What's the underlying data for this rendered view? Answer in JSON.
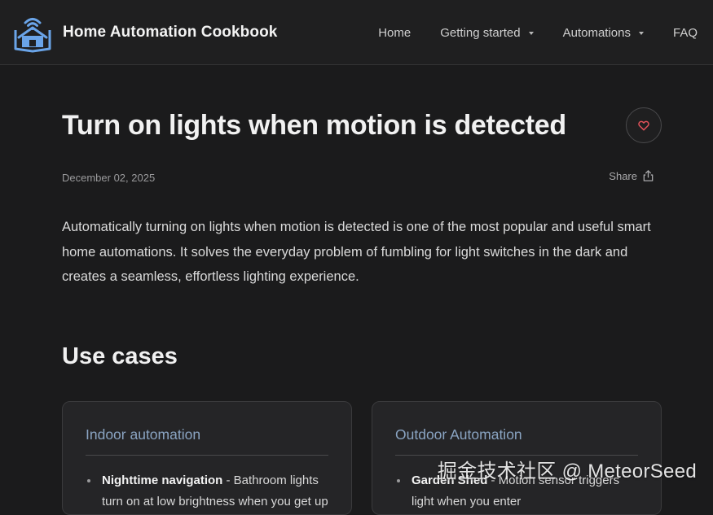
{
  "header": {
    "site_title": "Home Automation Cookbook",
    "logo_icon": "smart-home-wifi-icon",
    "nav": [
      {
        "label": "Home",
        "has_dropdown": false
      },
      {
        "label": "Getting started",
        "has_dropdown": true
      },
      {
        "label": "Automations",
        "has_dropdown": true
      },
      {
        "label": "FAQ",
        "has_dropdown": false
      }
    ]
  },
  "article": {
    "title": "Turn on lights when motion is detected",
    "favorite_icon": "heart-icon",
    "date": "December 02, 2025",
    "share_label": "Share",
    "share_icon": "share-icon",
    "intro": "Automatically turning on lights when motion is detected is one of the most popular and useful smart home automations. It solves the everyday problem of fumbling for light switches in the dark and creates a seamless, effortless lighting experience."
  },
  "use_cases": {
    "heading": "Use cases",
    "cards": [
      {
        "title": "Indoor automation",
        "items": [
          {
            "bold": "Nighttime navigation",
            "text": " - Bathroom lights turn on at low brightness when you get up"
          }
        ]
      },
      {
        "title": "Outdoor Automation",
        "items": [
          {
            "bold": "Garden Shed",
            "text": " - Motion sensor triggers light when you enter"
          }
        ]
      }
    ]
  },
  "watermark": "掘金技术社区 @ MeteorSeed",
  "colors": {
    "background": "#1b1b1c",
    "header_bg": "#1f1f20",
    "card_title": "#8aa4c2",
    "logo_blue": "#6aa4e8",
    "heart": "#e2525a"
  }
}
